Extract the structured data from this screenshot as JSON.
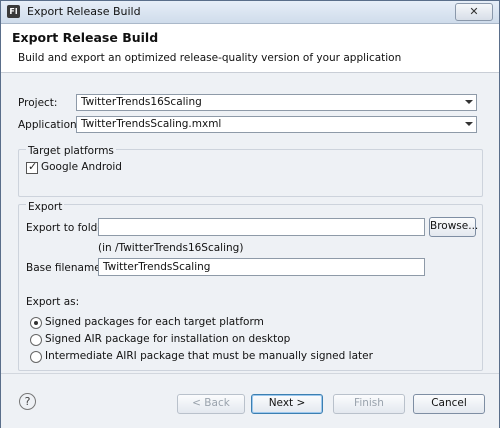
{
  "window": {
    "title": "Export Release Build",
    "app_icon": "Fl",
    "close_glyph": "✕"
  },
  "header": {
    "title": "Export Release Build",
    "subtitle": "Build and export an optimized release-quality version of your application"
  },
  "form": {
    "project_label": "Project:",
    "project_value": "TwitterTrends16Scaling",
    "application_label": "Application:",
    "application_value": "TwitterTrendsScaling.mxml"
  },
  "target_platforms": {
    "group_title": "Target platforms",
    "google_android_label": "Google Android",
    "google_android_checked": true
  },
  "export": {
    "group_title": "Export",
    "export_folder_label": "Export to folder:",
    "export_folder_value": "",
    "browse_label": "Browse...",
    "folder_hint": "(in /TwitterTrends16Scaling)",
    "base_filename_label": "Base filename:",
    "base_filename_value": "TwitterTrendsScaling",
    "export_as_label": "Export as:",
    "options": [
      {
        "label": "Signed packages for each target platform",
        "selected": true
      },
      {
        "label": "Signed AIR package for installation on desktop",
        "selected": false
      },
      {
        "label": "Intermediate AIRI package that must be manually signed later",
        "selected": false
      }
    ]
  },
  "footer": {
    "help_glyph": "?",
    "back_label": "< Back",
    "next_label": "Next >",
    "finish_label": "Finish",
    "cancel_label": "Cancel"
  }
}
